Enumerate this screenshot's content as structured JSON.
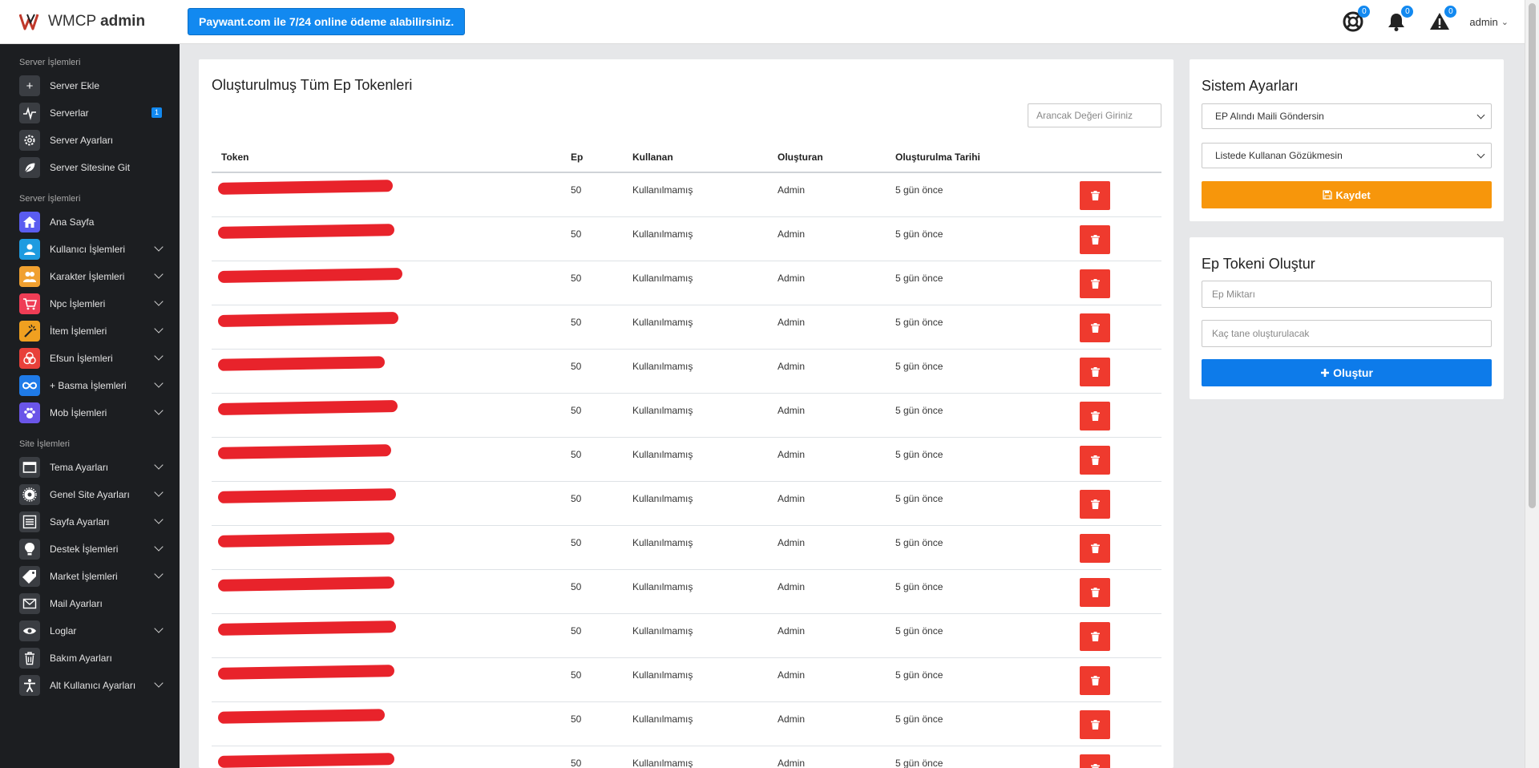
{
  "topbar": {
    "brand_light": "WMCP",
    "brand_bold": "admin",
    "promo": "Paywant.com ile 7/24 online ödeme alabilirsiniz.",
    "support_count": "0",
    "notification_count": "0",
    "alert_count": "0",
    "user": "admin"
  },
  "sidebar": {
    "section_1": "Server İşlemleri",
    "section_2": "Server İşlemleri",
    "section_3": "Site İşlemleri",
    "items": [
      {
        "label": "Server Ekle",
        "icon": "plus-icon"
      },
      {
        "label": "Serverlar",
        "icon": "pulse-icon",
        "badge": "1"
      },
      {
        "label": "Server Ayarları",
        "icon": "gear-icon"
      },
      {
        "label": "Server Sitesine Git",
        "icon": "leaf-icon"
      },
      {
        "label": "Ana Sayfa",
        "icon": "home-icon",
        "color": "#5a5cf0"
      },
      {
        "label": "Kullanıcı İşlemleri",
        "icon": "user-icon",
        "color": "#1e9be0"
      },
      {
        "label": "Karakter İşlemleri",
        "icon": "users-icon",
        "color": "#f0a030"
      },
      {
        "label": "Npc İşlemleri",
        "icon": "cart-icon",
        "color": "#ef3d55"
      },
      {
        "label": "İtem İşlemleri",
        "icon": "wand-icon",
        "color": "#f0a020"
      },
      {
        "label": "Efsun İşlemleri",
        "icon": "circles-icon",
        "color": "#e8403a"
      },
      {
        "label": "+ Basma İşlemleri",
        "icon": "infinity-icon",
        "color": "#1f7be8"
      },
      {
        "label": "Mob İşlemleri",
        "icon": "paw-icon",
        "color": "#6a55e8"
      },
      {
        "label": "Tema Ayarları",
        "icon": "window-icon"
      },
      {
        "label": "Genel Site Ayarları",
        "icon": "cog-icon"
      },
      {
        "label": "Sayfa Ayarları",
        "icon": "list-icon"
      },
      {
        "label": "Destek İşlemleri",
        "icon": "bulb-icon"
      },
      {
        "label": "Market İşlemleri",
        "icon": "tag-icon"
      },
      {
        "label": "Mail Ayarları",
        "icon": "mail-icon"
      },
      {
        "label": "Loglar",
        "icon": "eye-icon"
      },
      {
        "label": "Bakım Ayarları",
        "icon": "trash-icon"
      },
      {
        "label": "Alt Kullanıcı Ayarları",
        "icon": "person-icon"
      }
    ]
  },
  "tokens": {
    "title": "Oluşturulmuş Tüm Ep Tokenleri",
    "search_placeholder": "Arancak Değeri Giriniz",
    "headers": {
      "token": "Token",
      "ep": "Ep",
      "used_by": "Kullanan",
      "creator": "Oluşturan",
      "date": "Oluşturulma Tarihi"
    },
    "rows": [
      {
        "ep": "50",
        "used_by": "Kullanılmamış",
        "creator": "Admin",
        "date": "5 gün önce"
      },
      {
        "ep": "50",
        "used_by": "Kullanılmamış",
        "creator": "Admin",
        "date": "5 gün önce"
      },
      {
        "ep": "50",
        "used_by": "Kullanılmamış",
        "creator": "Admin",
        "date": "5 gün önce"
      },
      {
        "ep": "50",
        "used_by": "Kullanılmamış",
        "creator": "Admin",
        "date": "5 gün önce"
      },
      {
        "ep": "50",
        "used_by": "Kullanılmamış",
        "creator": "Admin",
        "date": "5 gün önce"
      },
      {
        "ep": "50",
        "used_by": "Kullanılmamış",
        "creator": "Admin",
        "date": "5 gün önce"
      },
      {
        "ep": "50",
        "used_by": "Kullanılmamış",
        "creator": "Admin",
        "date": "5 gün önce"
      },
      {
        "ep": "50",
        "used_by": "Kullanılmamış",
        "creator": "Admin",
        "date": "5 gün önce"
      },
      {
        "ep": "50",
        "used_by": "Kullanılmamış",
        "creator": "Admin",
        "date": "5 gün önce"
      },
      {
        "ep": "50",
        "used_by": "Kullanılmamış",
        "creator": "Admin",
        "date": "5 gün önce"
      },
      {
        "ep": "50",
        "used_by": "Kullanılmamış",
        "creator": "Admin",
        "date": "5 gün önce"
      },
      {
        "ep": "50",
        "used_by": "Kullanılmamış",
        "creator": "Admin",
        "date": "5 gün önce"
      },
      {
        "ep": "50",
        "used_by": "Kullanılmamış",
        "creator": "Admin",
        "date": "5 gün önce"
      },
      {
        "ep": "50",
        "used_by": "Kullanılmamış",
        "creator": "Admin",
        "date": "5 gün önce"
      }
    ]
  },
  "settings": {
    "title": "Sistem Ayarları",
    "select_1": "EP Alındı Maili Göndersin",
    "select_2": "Listede Kullanan Gözükmesin",
    "save_label": "Kaydet"
  },
  "create": {
    "title": "Ep Tokeni Oluştur",
    "amount_placeholder": "Ep Miktarı",
    "count_placeholder": "Kaç tane oluşturulacak",
    "create_label": "Oluştur"
  },
  "colors": {
    "primary": "#1289f0",
    "danger": "#ef3a2e",
    "warning": "#f7960b",
    "sidebar": "#1c1e21"
  }
}
